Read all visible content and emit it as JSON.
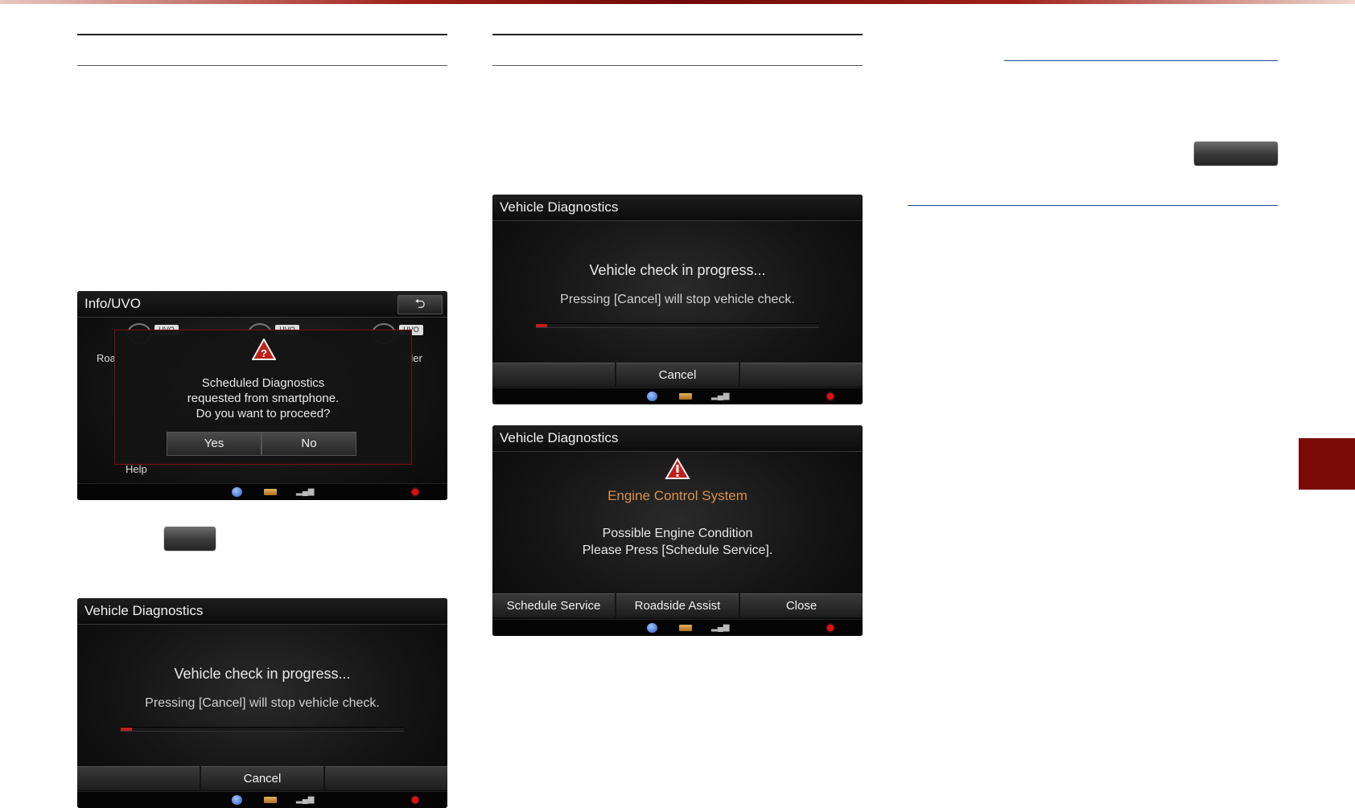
{
  "screens": {
    "info_uvo": {
      "title": "Info/UVO",
      "back_icon": "back-arrow-icon",
      "ghost_labels": [
        "Roa",
        "der",
        "Help"
      ],
      "ghost_tag": "UVO",
      "dialog": {
        "icon": "warning-question-icon",
        "message_lines": [
          "Scheduled Diagnostics",
          "requested from smartphone.",
          "Do you want to proceed?"
        ],
        "yes_label": "Yes",
        "no_label": "No"
      }
    },
    "progress_a": {
      "title": "Vehicle Diagnostics",
      "heading": "Vehicle check in progress...",
      "message": "Pressing [Cancel] will stop vehicle check.",
      "progress": 0.04,
      "cancel_label": "Cancel"
    },
    "progress_b": {
      "title": "Vehicle Diagnostics",
      "heading": "Vehicle check in progress...",
      "message": "Pressing [Cancel] will stop vehicle check.",
      "progress": 0.04,
      "cancel_label": "Cancel"
    },
    "result": {
      "title": "Vehicle Diagnostics",
      "icon": "warning-icon",
      "system_name": "Engine Control System",
      "message_lines": [
        "Possible Engine Condition",
        "Please Press [Schedule Service]."
      ],
      "buttons": [
        "Schedule Service",
        "Roadside Assist",
        "Close"
      ]
    }
  },
  "status_icons": [
    "globe-icon",
    "battery-icon",
    "signal-icon",
    "record-dot-icon"
  ],
  "colors": {
    "brand_red": "#7a0a06",
    "accent_blue_rule": "#1e4a8a",
    "warning_red": "#c0201a",
    "title_orange": "#d8904a"
  }
}
